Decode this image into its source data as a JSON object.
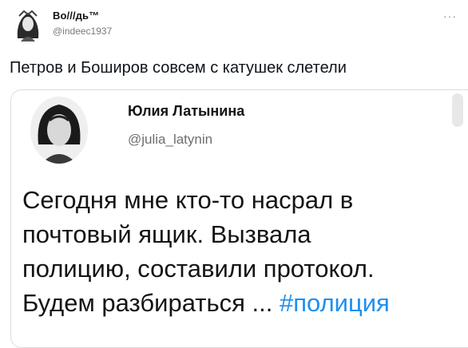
{
  "author": {
    "display_name": "Bo///дь™",
    "handle": "@indeec1937",
    "more_icon": "more-dots-icon"
  },
  "tweet": {
    "text": "Петров и Боширов совсем с катушек слетели"
  },
  "quoted": {
    "display_name": "Юлия Латынина",
    "handle": "@julia_latynin",
    "lines": [
      "Сегодня мне кто-то насрал в",
      "почтовый ящик. Вызвала",
      "полицию, составили протокол.",
      "Будем разбираться ..."
    ],
    "hashtag": "#полиция"
  },
  "colors": {
    "hashtag": "#1d8ff0",
    "handle": "#7a7a7a",
    "border": "#dcdcdc"
  }
}
